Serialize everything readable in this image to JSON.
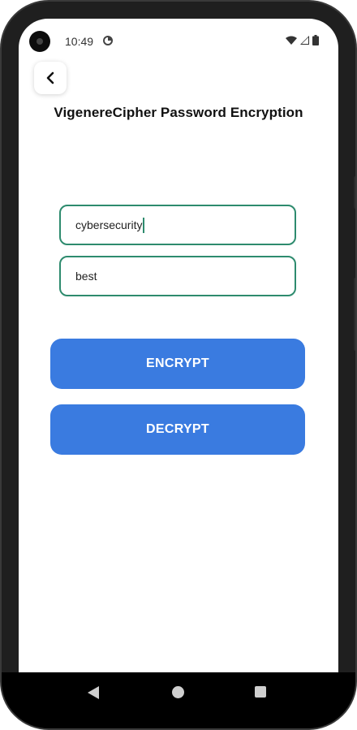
{
  "status_bar": {
    "time": "10:49",
    "icons": [
      "camera-icon",
      "data-saver-icon",
      "wifi-icon",
      "signal-icon",
      "battery-icon"
    ]
  },
  "header": {
    "back_icon": "chevron-left-icon",
    "title": "VigenereCipher Password Encryption"
  },
  "form": {
    "password_value": "cybersecurity",
    "key_value": "best"
  },
  "actions": {
    "encrypt_label": "ENCRYPT",
    "decrypt_label": "DECRYPT"
  },
  "colors": {
    "accent": "#3a7be0",
    "field_border": "#2e8b6e"
  },
  "nav_bar": {
    "icons": [
      "nav-back-icon",
      "nav-home-icon",
      "nav-recents-icon"
    ]
  }
}
